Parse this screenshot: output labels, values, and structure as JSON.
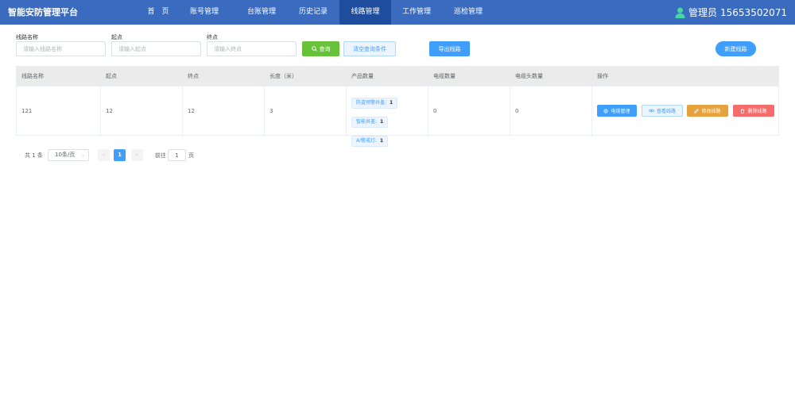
{
  "header": {
    "brand": "智能安防管理平台",
    "nav": [
      {
        "label": "首　页"
      },
      {
        "label": "账号管理"
      },
      {
        "label": "台账管理"
      },
      {
        "label": "历史记录"
      },
      {
        "label": "线路管理",
        "active": true
      },
      {
        "label": "工作管理"
      },
      {
        "label": "巡检管理"
      }
    ],
    "user": {
      "role": "管理员",
      "phone": "15653502071"
    },
    "colors": {
      "bar": "#3a6bbf",
      "active": "#1d4d9c"
    }
  },
  "filters": {
    "route_name": {
      "label": "线路名称",
      "placeholder": "请输入线路名称",
      "value": ""
    },
    "start": {
      "label": "起点",
      "placeholder": "请输入起点",
      "value": ""
    },
    "end": {
      "label": "终点",
      "placeholder": "请输入终点",
      "value": ""
    },
    "search_label": "查询",
    "clear_label": "清空查询条件",
    "export_label": "导出线路",
    "new_label": "新建线路"
  },
  "table": {
    "columns": [
      "线路名称",
      "起点",
      "终点",
      "长度（米）",
      "产品数量",
      "电缆数量",
      "电缆头数量",
      "操作"
    ],
    "rows": [
      {
        "name": "121",
        "start": "12",
        "end": "12",
        "length": "3",
        "products": [
          {
            "label": "防盗预警井盖:",
            "count": "1"
          },
          {
            "label": "智能井盖:",
            "count": "1"
          },
          {
            "label": "AI警戒灯:",
            "count": "1"
          }
        ],
        "cables": "0",
        "cable_heads": "0",
        "actions": {
          "cable": "电缆管理",
          "view": "查看线路",
          "edit": "修改线路",
          "delete": "删除线路"
        }
      }
    ]
  },
  "pagination": {
    "total": "共 1 条",
    "page_size": "10条/页",
    "current": "1",
    "goto_label": "前往",
    "goto_value": "1",
    "unit": "页"
  }
}
